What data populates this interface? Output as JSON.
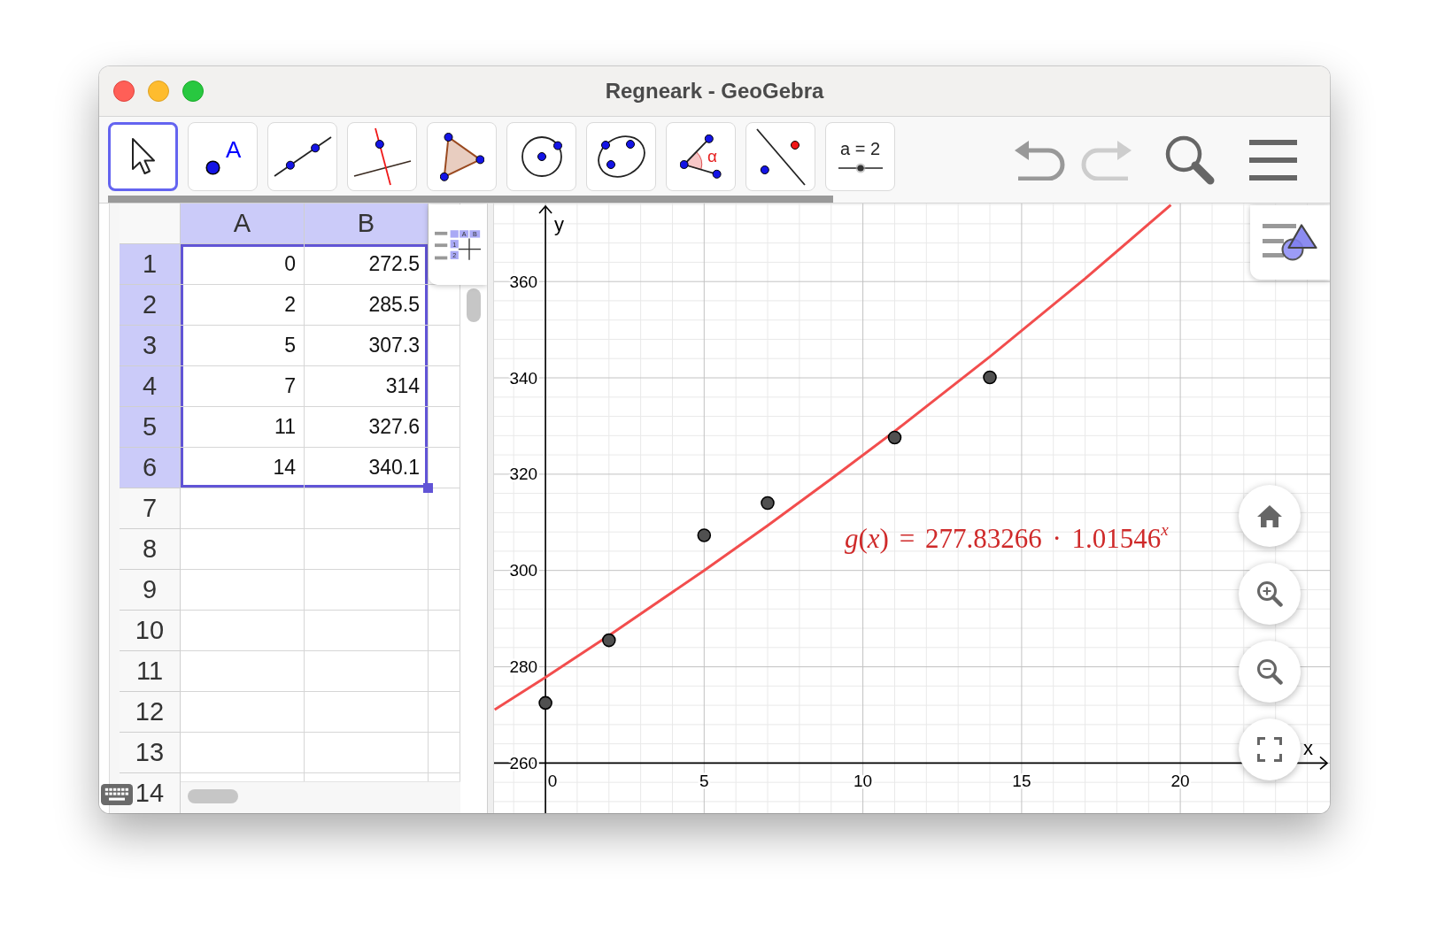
{
  "window": {
    "title": "Regneark - GeoGebra"
  },
  "toolbar": {
    "tools": [
      {
        "kind": "move",
        "selected": true
      },
      {
        "kind": "point",
        "label": "A",
        "selected": false
      },
      {
        "kind": "line",
        "selected": false
      },
      {
        "kind": "perpendicular",
        "selected": false
      },
      {
        "kind": "polygon",
        "selected": false
      },
      {
        "kind": "circle",
        "selected": false
      },
      {
        "kind": "conic",
        "selected": false
      },
      {
        "kind": "angle",
        "label": "α",
        "selected": false
      },
      {
        "kind": "reflect",
        "selected": false
      },
      {
        "kind": "slider",
        "label": "a = 2",
        "selected": false
      }
    ],
    "undo": {
      "disabled": false
    },
    "redo": {
      "disabled": true
    }
  },
  "spreadsheet": {
    "style_button": {
      "labels": [
        "A",
        "B",
        "1",
        "2"
      ]
    },
    "columns": [
      {
        "label": "A",
        "selected": true
      },
      {
        "label": "B",
        "selected": true
      }
    ],
    "rows": [
      {
        "label": "1",
        "selected": true,
        "cells": [
          "0",
          "272.5"
        ]
      },
      {
        "label": "2",
        "selected": true,
        "cells": [
          "2",
          "285.5"
        ]
      },
      {
        "label": "3",
        "selected": true,
        "cells": [
          "5",
          "307.3"
        ]
      },
      {
        "label": "4",
        "selected": true,
        "cells": [
          "7",
          "314"
        ]
      },
      {
        "label": "5",
        "selected": true,
        "cells": [
          "11",
          "327.6"
        ]
      },
      {
        "label": "6",
        "selected": true,
        "cells": [
          "14",
          "340.1"
        ]
      },
      {
        "label": "7",
        "selected": false
      },
      {
        "label": "8",
        "selected": false
      },
      {
        "label": "9",
        "selected": false
      },
      {
        "label": "10",
        "selected": false
      },
      {
        "label": "11",
        "selected": false
      },
      {
        "label": "12",
        "selected": false
      },
      {
        "label": "13",
        "selected": false
      },
      {
        "label": "14",
        "selected": false
      }
    ]
  },
  "graphics_view": {
    "function_label": "*g*(*x*) = 277.83266 · 1.01546$^{x}$",
    "chart_data": {
      "type": "scatter",
      "xlabel": "x",
      "ylabel": "y",
      "grid": true,
      "x": [
        -1.6,
        0,
        2,
        5,
        7,
        9,
        11,
        14,
        17,
        19.7
      ],
      "series": [
        {
          "color": "#505050",
          "values": [
            null,
            272.5,
            285.5,
            307.3,
            314,
            null,
            327.6,
            340.1,
            null,
            null
          ]
        },
        {
          "type": "line",
          "color": "#f24d4d",
          "values": [
            271.1,
            277.8,
            286.5,
            300.0,
            309.3,
            319.0,
            328.9,
            344.4,
            360.6,
            375.9
          ]
        }
      ],
      "xlim": [
        -1.62,
        24.71
      ],
      "ylim": [
        249.6,
        376.2
      ],
      "xticks": [
        0,
        5,
        10,
        15,
        20
      ],
      "yticks": [
        260,
        280,
        300,
        320,
        340,
        360
      ]
    }
  }
}
